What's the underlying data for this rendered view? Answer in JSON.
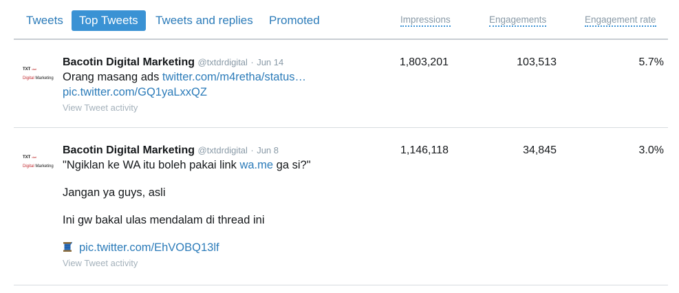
{
  "tabs": [
    {
      "label": "Tweets"
    },
    {
      "label": "Top Tweets"
    },
    {
      "label": "Tweets and replies"
    },
    {
      "label": "Promoted"
    }
  ],
  "columns": {
    "impressions": "Impressions",
    "engagements": "Engagements",
    "rate": "Engagement rate"
  },
  "avatar": {
    "line1": "TXT",
    "line1_small": "dari",
    "line2_a": "Digital",
    "line2_b": " Marketing"
  },
  "tweets": [
    {
      "name": "Bacotin Digital Marketing",
      "handle": "@txtdrdigital",
      "dot": "·",
      "date": "Jun 14",
      "text_prefix": "Orang masang ads ",
      "text_link": "twitter.com/m4retha/status…",
      "pic_link": "pic.twitter.com/GQ1yaLxxQZ",
      "activity": "View Tweet activity",
      "impressions": "1,803,201",
      "engagements": "103,513",
      "rate": "5.7%"
    },
    {
      "name": "Bacotin Digital Marketing",
      "handle": "@txtdrdigital",
      "dot": "·",
      "date": "Jun 8",
      "line1_prefix": "\"Ngiklan ke WA itu boleh pakai link ",
      "line1_link": "wa.me",
      "line1_suffix": " ga si?\"",
      "line2": "Jangan ya guys, asli",
      "line3": "Ini gw bakal ulas mendalam di thread ini",
      "pic_link": "pic.twitter.com/EhVOBQ13lf",
      "activity": "View Tweet activity",
      "impressions": "1,146,118",
      "engagements": "34,845",
      "rate": "3.0%"
    }
  ],
  "colors": {
    "accent": "#3a92d4",
    "link": "#2b7bb9",
    "muted": "#8899a6"
  }
}
